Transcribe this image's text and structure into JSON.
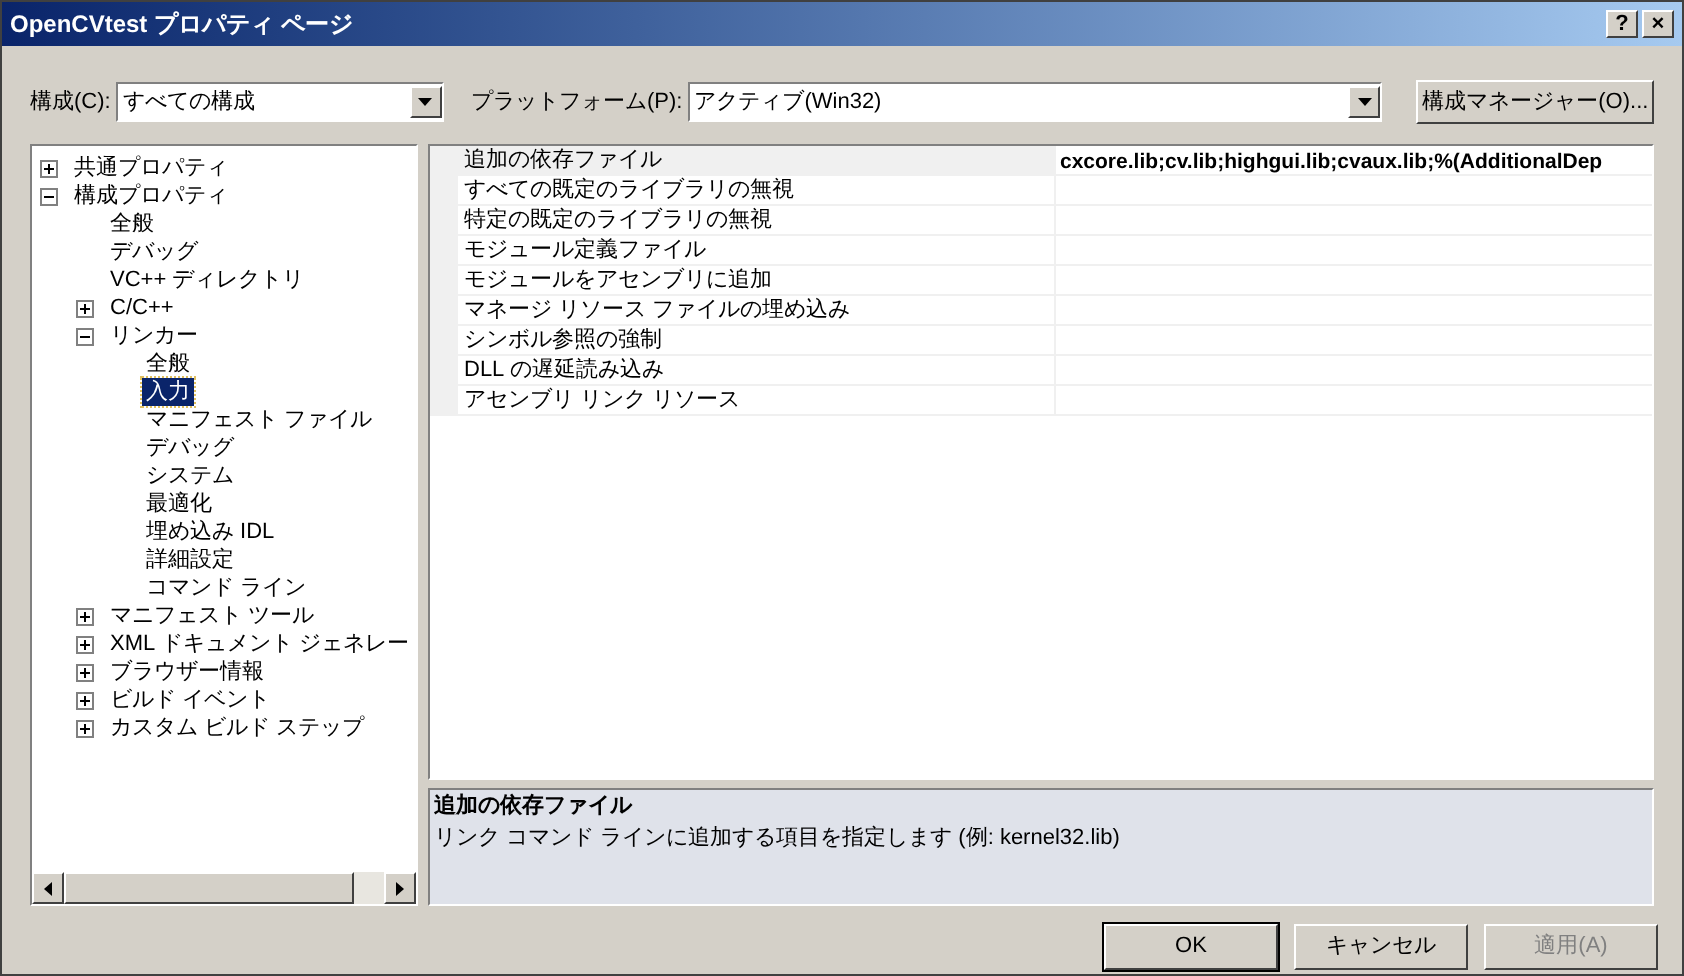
{
  "window": {
    "title": "OpenCVtest プロパティ ページ",
    "buttons": [
      "?",
      "×"
    ]
  },
  "config": {
    "label": "構成(C):",
    "value": "すべての構成"
  },
  "platform": {
    "label": "プラットフォーム(P):",
    "value": "アクティブ(Win32)"
  },
  "config_manager_button": "構成マネージャー(O)...",
  "tree": [
    {
      "label": "共通プロパティ",
      "expanded": false,
      "selected": false
    },
    {
      "label": "構成プロパティ",
      "expanded": true,
      "selected": false,
      "children": [
        {
          "label": "全般",
          "selected": false
        },
        {
          "label": "デバッグ",
          "selected": false
        },
        {
          "label": "VC++ ディレクトリ",
          "selected": false
        },
        {
          "label": "C/C++",
          "expanded": false,
          "selected": false
        },
        {
          "label": "リンカー",
          "expanded": true,
          "selected": false,
          "children": [
            {
              "label": "全般",
              "selected": false
            },
            {
              "label": "入力",
              "selected": true
            },
            {
              "label": "マニフェスト ファイル",
              "selected": false
            },
            {
              "label": "デバッグ",
              "selected": false
            },
            {
              "label": "システム",
              "selected": false
            },
            {
              "label": "最適化",
              "selected": false
            },
            {
              "label": "埋め込み IDL",
              "selected": false
            },
            {
              "label": "詳細設定",
              "selected": false
            },
            {
              "label": "コマンド ライン",
              "selected": false
            }
          ]
        },
        {
          "label": "マニフェスト ツール",
          "expanded": false,
          "selected": false
        },
        {
          "label": "XML ドキュメント ジェネレー",
          "expanded": false,
          "selected": false
        },
        {
          "label": "ブラウザー情報",
          "expanded": false,
          "selected": false
        },
        {
          "label": "ビルド イベント",
          "expanded": false,
          "selected": false
        },
        {
          "label": "カスタム ビルド ステップ",
          "expanded": false,
          "selected": false
        }
      ]
    }
  ],
  "properties": [
    {
      "name": "追加の依存ファイル",
      "value": "cxcore.lib;cv.lib;highgui.lib;cvaux.lib;%(AdditionalDep",
      "selected": true
    },
    {
      "name": "すべての既定のライブラリの無視",
      "selected": false
    },
    {
      "name": "特定の既定のライブラリの無視",
      "selected": false
    },
    {
      "name": "モジュール定義ファイル",
      "selected": false
    },
    {
      "name": "モジュールをアセンブリに追加",
      "selected": false
    },
    {
      "name": "マネージ リソース ファイルの埋め込み",
      "selected": false
    },
    {
      "name": "シンボル参照の強制",
      "selected": false
    },
    {
      "name": "DLL の遅延読み込み",
      "selected": false
    },
    {
      "name": "アセンブリ リンク リソース",
      "selected": false
    }
  ],
  "description": {
    "title": "追加の依存ファイル",
    "text": "リンク コマンド ラインに追加する項目を指定します (例: kernel32.lib)"
  },
  "buttons": [
    {
      "label": "OK",
      "disabled": false,
      "default": true
    },
    {
      "label": "キャンセル",
      "disabled": false,
      "default": false
    },
    {
      "label": "適用(A)",
      "disabled": true,
      "default": false
    }
  ]
}
